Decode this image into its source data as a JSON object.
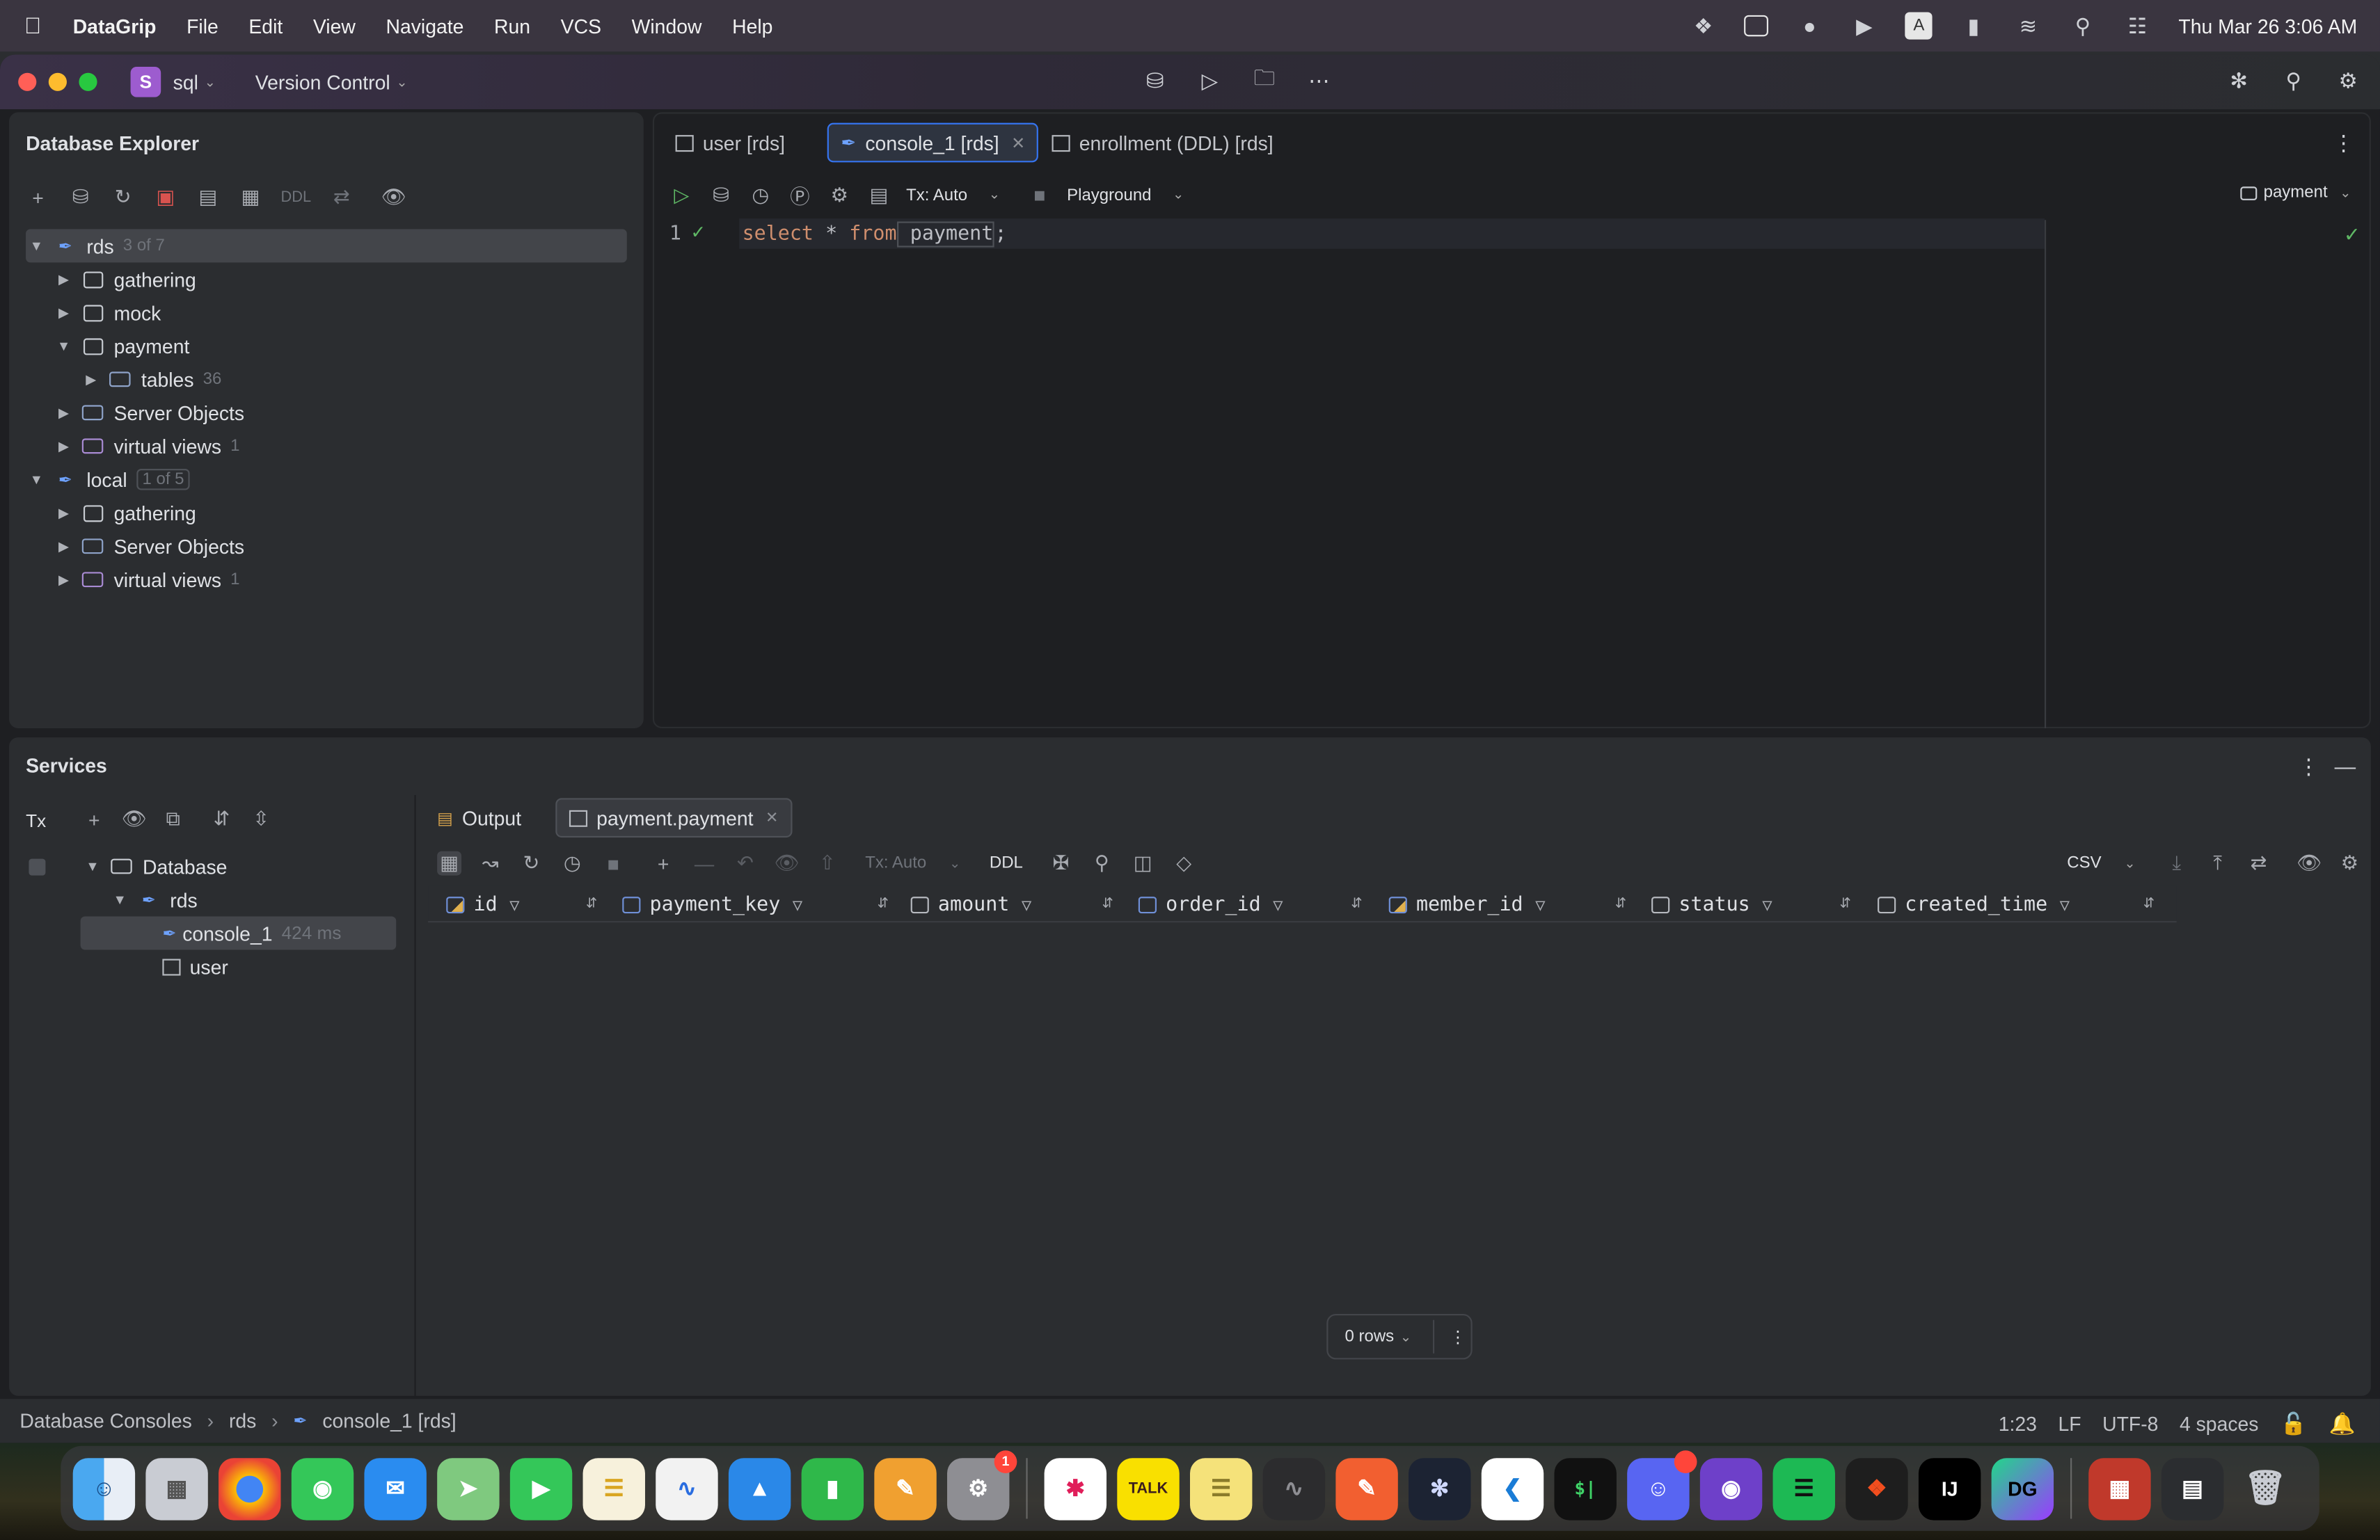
{
  "menubar": {
    "app_name": "DataGrip",
    "menus": [
      "File",
      "Edit",
      "View",
      "Navigate",
      "Run",
      "VCS",
      "Window",
      "Help"
    ],
    "clock": "Thu Mar 26  3:06 AM"
  },
  "titlebar": {
    "project_initial": "S",
    "project_name": "sql",
    "vcs_label": "Version Control"
  },
  "db_explorer": {
    "title": "Database Explorer",
    "ddl_label": "DDL",
    "tree": [
      {
        "label": "rds",
        "count": "3 of 7"
      },
      {
        "label": "gathering"
      },
      {
        "label": "mock"
      },
      {
        "label": "payment"
      },
      {
        "label": "tables",
        "count": "36"
      },
      {
        "label": "Server Objects"
      },
      {
        "label": "virtual views",
        "count": "1"
      },
      {
        "label": "local",
        "count": "1 of 5"
      },
      {
        "label": "gathering"
      },
      {
        "label": "Server Objects"
      },
      {
        "label": "virtual views",
        "count": "1"
      }
    ]
  },
  "editor": {
    "tabs": [
      {
        "label": "user [rds]"
      },
      {
        "label": "console_1 [rds]"
      },
      {
        "label": "enrollment (DDL) [rds]"
      }
    ],
    "tx_label": "Tx: Auto",
    "playground_label": "Playground",
    "schema_label": "payment",
    "line_number": "1",
    "code": {
      "kw1": "select",
      "star": " * ",
      "kw2": "from",
      "table": " payment",
      "semi": ";"
    }
  },
  "services": {
    "title": "Services",
    "tx_label": "Tx",
    "tree": [
      {
        "label": "Database"
      },
      {
        "label": "rds"
      },
      {
        "label": "console_1",
        "time": "424 ms"
      },
      {
        "label": "user"
      }
    ],
    "tabs": [
      {
        "label": "Output"
      },
      {
        "label": "payment.payment"
      }
    ],
    "grid_tx_label": "Tx: Auto",
    "grid_ddl_label": "DDL",
    "export_label": "CSV",
    "columns": [
      "id",
      "payment_key",
      "amount",
      "order_id",
      "member_id",
      "status",
      "created_time"
    ],
    "rows_label": "0 rows"
  },
  "statusbar": {
    "breadcrumb": [
      "Database Consoles",
      "rds",
      "console_1 [rds]"
    ],
    "position": "1:23",
    "line_sep": "LF",
    "encoding": "UTF-8",
    "indent": "4 spaces"
  },
  "dock": {
    "apps": [
      "finder",
      "launchpad",
      "chrome",
      "messages",
      "mail",
      "maps",
      "facetime",
      "notes",
      "freeform",
      "keynote",
      "numbers",
      "pages",
      "system-settings",
      "slack",
      "kakaotalk",
      "stickies",
      "activity-monitor",
      "pencil",
      "chatgpt",
      "vscode",
      "terminal",
      "discord",
      "github",
      "spotify",
      "figma",
      "intellij",
      "datagrip"
    ],
    "settings_badge": "1"
  }
}
